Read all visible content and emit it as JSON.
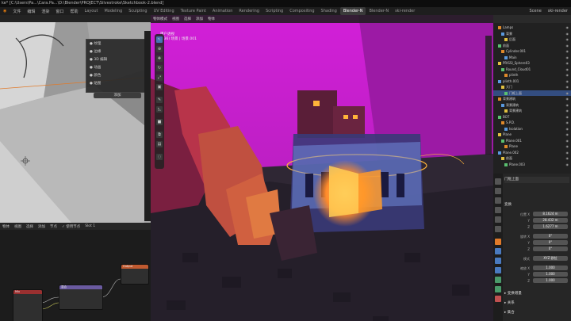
{
  "titlebar": {
    "text": "ke* [C:\\Users\\Pa...\\Cara.Pa...\\D:\\Blender\\PROJECT\\Silvestroke\\Sketchbook-2.blend]"
  },
  "menubar": {
    "items": [
      "文件",
      "编辑",
      "渲染",
      "窗口",
      "帮助"
    ],
    "workspaces": [
      "Layout",
      "Modeling",
      "Sculpting",
      "UV Editing",
      "Texture Paint",
      "Animation",
      "Rendering",
      "Scripting",
      "Compositing",
      "Shading",
      "Blender-N",
      "Blender-N",
      "ski-render"
    ],
    "active_workspace": "Blender-N",
    "scene_label": "Scene",
    "view_layer": "ski-render"
  },
  "image_editor": {
    "panel_rows": [
      "● 纹理",
      "● 边缘",
      "● 3D 编辑",
      "● 动画",
      "● 颜色",
      "● 贴图"
    ],
    "button_label": "添加"
  },
  "node_editor": {
    "header_items": [
      "物体",
      "视图",
      "选择",
      "添加",
      "节点",
      "✓ 使用节点",
      "Slot 1"
    ],
    "nodes": [
      {
        "title": "Mix",
        "color": "#9a3030"
      },
      {
        "title": "混合",
        "color": "#6a5aa0"
      },
      {
        "title": "Output",
        "color": "#c05a30"
      }
    ]
  },
  "viewport": {
    "header_items": [
      "物体模式",
      "视图",
      "选择",
      "添加",
      "物体"
    ],
    "info_line1": "用户透视",
    "info_line2": "(136) 场景 | 场景.001",
    "colors": {
      "sky": "#c41fd0",
      "ground": "#2b2530",
      "glow": "#ffb43a"
    }
  },
  "outliner": {
    "rows": [
      {
        "label": "Lamps",
        "selected": false
      },
      {
        "label": "背景",
        "selected": false
      },
      {
        "label": "后面",
        "selected": false
      },
      {
        "label": "前面",
        "selected": false
      },
      {
        "label": "Cylinder.001",
        "selected": false
      },
      {
        "label": "Main",
        "selected": false
      },
      {
        "label": "PRISSI_Sphere03",
        "selected": false
      },
      {
        "label": "Round_Cloud01",
        "selected": false
      },
      {
        "label": "plinth",
        "selected": false
      },
      {
        "label": "plinth.001",
        "selected": false
      },
      {
        "label": "大门",
        "selected": false
      },
      {
        "label": "门框上面",
        "selected": true
      },
      {
        "label": "背景建筑",
        "selected": false
      },
      {
        "label": "背景建筑",
        "selected": false
      },
      {
        "label": "背景建筑",
        "selected": false
      },
      {
        "label": "BOT",
        "selected": false
      },
      {
        "label": "S.P.D.",
        "selected": false
      },
      {
        "label": "Isolation",
        "selected": false
      },
      {
        "label": "Plane",
        "selected": false
      },
      {
        "label": "Plane.001",
        "selected": false
      },
      {
        "label": "Plane",
        "selected": false
      },
      {
        "label": "Plane.002",
        "selected": false
      },
      {
        "label": "前面",
        "selected": false
      },
      {
        "label": "Plane.003",
        "selected": false
      }
    ]
  },
  "properties": {
    "object_name": "门框上面",
    "section_transform": "变换",
    "location_label": "位置 X",
    "location": [
      "8.1624 m",
      "28.432 m",
      "1.6277 m"
    ],
    "rotation_label": "旋转 X",
    "rotation": [
      "0°",
      "0°",
      "0°"
    ],
    "mode_label": "模式",
    "rotation_mode": "XYZ 欧拉",
    "scale_label": "缩放 X",
    "scale": [
      "1.000",
      "1.000",
      "1.000"
    ],
    "delta_label": "▸ 变换增量",
    "relations_label": "▸ 关系",
    "collections_label": "▸ 集合"
  }
}
